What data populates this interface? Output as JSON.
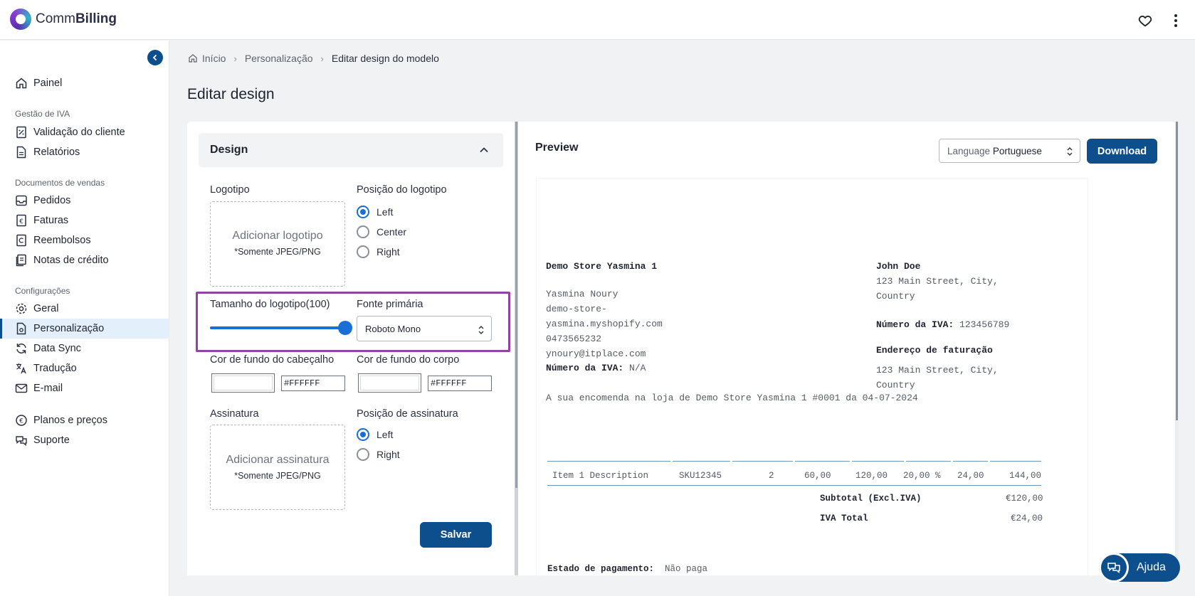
{
  "app": {
    "brand_light": "Comm",
    "brand_bold": "Billing",
    "accent_color": "#0d4e8c"
  },
  "topbar": {
    "favorite_icon": "heart-icon",
    "menu_icon": "more-vertical-icon"
  },
  "sidebar": {
    "items": [
      {
        "label": "Painel",
        "icon": "home-icon"
      },
      {
        "label": "Validação do cliente",
        "icon": "percent-doc-icon"
      },
      {
        "label": "Relatórios",
        "icon": "report-icon"
      },
      {
        "label": "Pedidos",
        "icon": "inbox-icon"
      },
      {
        "label": "Faturas",
        "icon": "euro-doc-icon"
      },
      {
        "label": "Reembolsos",
        "icon": "refund-doc-icon"
      },
      {
        "label": "Notas de crédito",
        "icon": "credit-note-icon"
      },
      {
        "label": "Geral",
        "icon": "gear-icon"
      },
      {
        "label": "Personalização",
        "icon": "customize-doc-icon",
        "active": true
      },
      {
        "label": "Data Sync",
        "icon": "sync-icon"
      },
      {
        "label": "Tradução",
        "icon": "translate-icon"
      },
      {
        "label": "E-mail",
        "icon": "mail-icon"
      },
      {
        "label": "Planos e preços",
        "icon": "euro-circle-icon"
      },
      {
        "label": "Suporte",
        "icon": "chat-icon"
      }
    ],
    "sections": [
      "Gestão de IVA",
      "Documentos de vendas",
      "Configurações"
    ]
  },
  "breadcrumb": [
    "Início",
    "Personalização",
    "Editar design do modelo"
  ],
  "page_title": "Editar design",
  "design": {
    "header": "Design",
    "logo_label": "Logotipo",
    "logo_drop": "Adicionar logotipo",
    "logo_hint": "*Somente JPEG/PNG",
    "logo_position_label": "Posição do logotipo",
    "logo_positions": [
      "Left",
      "Center",
      "Right"
    ],
    "logo_position_selected": "Left",
    "logo_size_label": "Tamanho do logotipo(100)",
    "logo_size_value": 100,
    "primary_font_label": "Fonte primária",
    "primary_font_value": "Roboto Mono",
    "header_bg_label": "Cor de fundo do cabeçalho",
    "header_bg_value": "#FFFFFF",
    "body_bg_label": "Cor de fundo do corpo",
    "body_bg_value": "#FFFFFF",
    "signature_label": "Assinatura",
    "signature_drop": "Adicionar assinatura",
    "signature_hint": "*Somente JPEG/PNG",
    "signature_position_label": "Posição de assinatura",
    "signature_positions": [
      "Left",
      "Right"
    ],
    "signature_position_selected": "Left",
    "save_label": "Salvar"
  },
  "preview": {
    "title": "Preview",
    "language_label": "Language",
    "language_value": "Portuguese",
    "download_label": "Download",
    "invoice": {
      "store_name": "Demo Store Yasmina 1",
      "store_owner": "Yasmina Noury",
      "store_url_1": "demo-store-",
      "store_url_2": "yasmina.myshopify.com",
      "store_phone": "0473565232",
      "store_email": "ynoury@itplace.com",
      "vat_label": "Número da IVA:",
      "store_vat": "N/A",
      "customer_name": "John Doe",
      "customer_address_1": "123 Main Street, City,",
      "customer_address_2": "Country",
      "customer_vat": "123456789",
      "billing_label": "Endereço de faturação",
      "billing_address_1": "123 Main Street, City,",
      "billing_address_2": "Country",
      "order_line": "A sua encomenda na loja de Demo Store Yasmina 1 #0001 da 04-07-2024",
      "items": [
        {
          "description": "Item 1 Description",
          "sku": "SKU12345",
          "qty": "2",
          "price": "60,00",
          "net": "120,00",
          "vat_rate": "20,00 %",
          "vat": "24,00",
          "total": "144,00"
        }
      ],
      "subtotal_label": "Subtotal (Excl.IVA)",
      "subtotal_value": "€120,00",
      "vat_total_label": "IVA Total",
      "vat_total_value": "€24,00",
      "payment_status_label": "Estado de pagamento:",
      "payment_status_value": "Não paga"
    }
  },
  "help": {
    "label": "Ajuda",
    "icon": "chat-bubbles-icon"
  }
}
